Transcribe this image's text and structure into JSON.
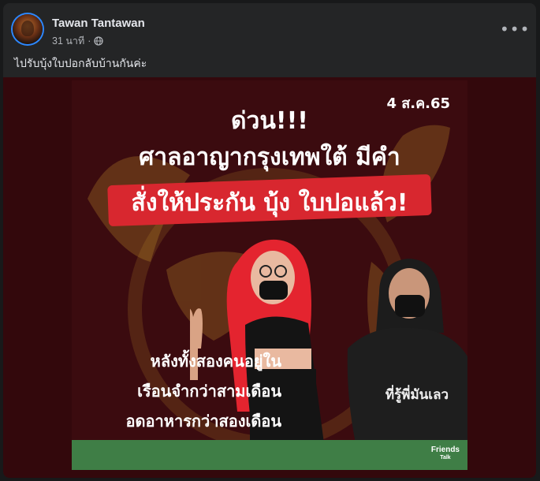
{
  "post": {
    "author": "Tawan Tantawan",
    "time": "31 นาที",
    "separator": "·",
    "privacy_icon": "globe-icon",
    "more_icon": "more-horizontal-icon",
    "more_label": "•••",
    "caption": "ไปรับบุ้งใบปอกลับบ้านกันค่ะ"
  },
  "image": {
    "date": "4 ส.ค.65",
    "headline_1": "ด่วน!!!",
    "headline_2": "ศาลอาญากรุงเทพใต้ มีคำ",
    "headline_3": "สั่งให้ประกัน บุ้ง ใบปอแล้ว!",
    "shirt_text": "ที่รู้พี่มันเลว",
    "sub_1": "หลังทั้งสองคนอยู่ใน",
    "sub_2": "เรือนจำกว่าสามเดือน",
    "sub_3": "อดอาหารกว่าสองเดือน",
    "logo_top": "Friends",
    "logo_bottom": "Talk",
    "colors": {
      "background": "#3b0b0f",
      "highlight": "#d8272f",
      "footer": "#3f7e46"
    }
  }
}
